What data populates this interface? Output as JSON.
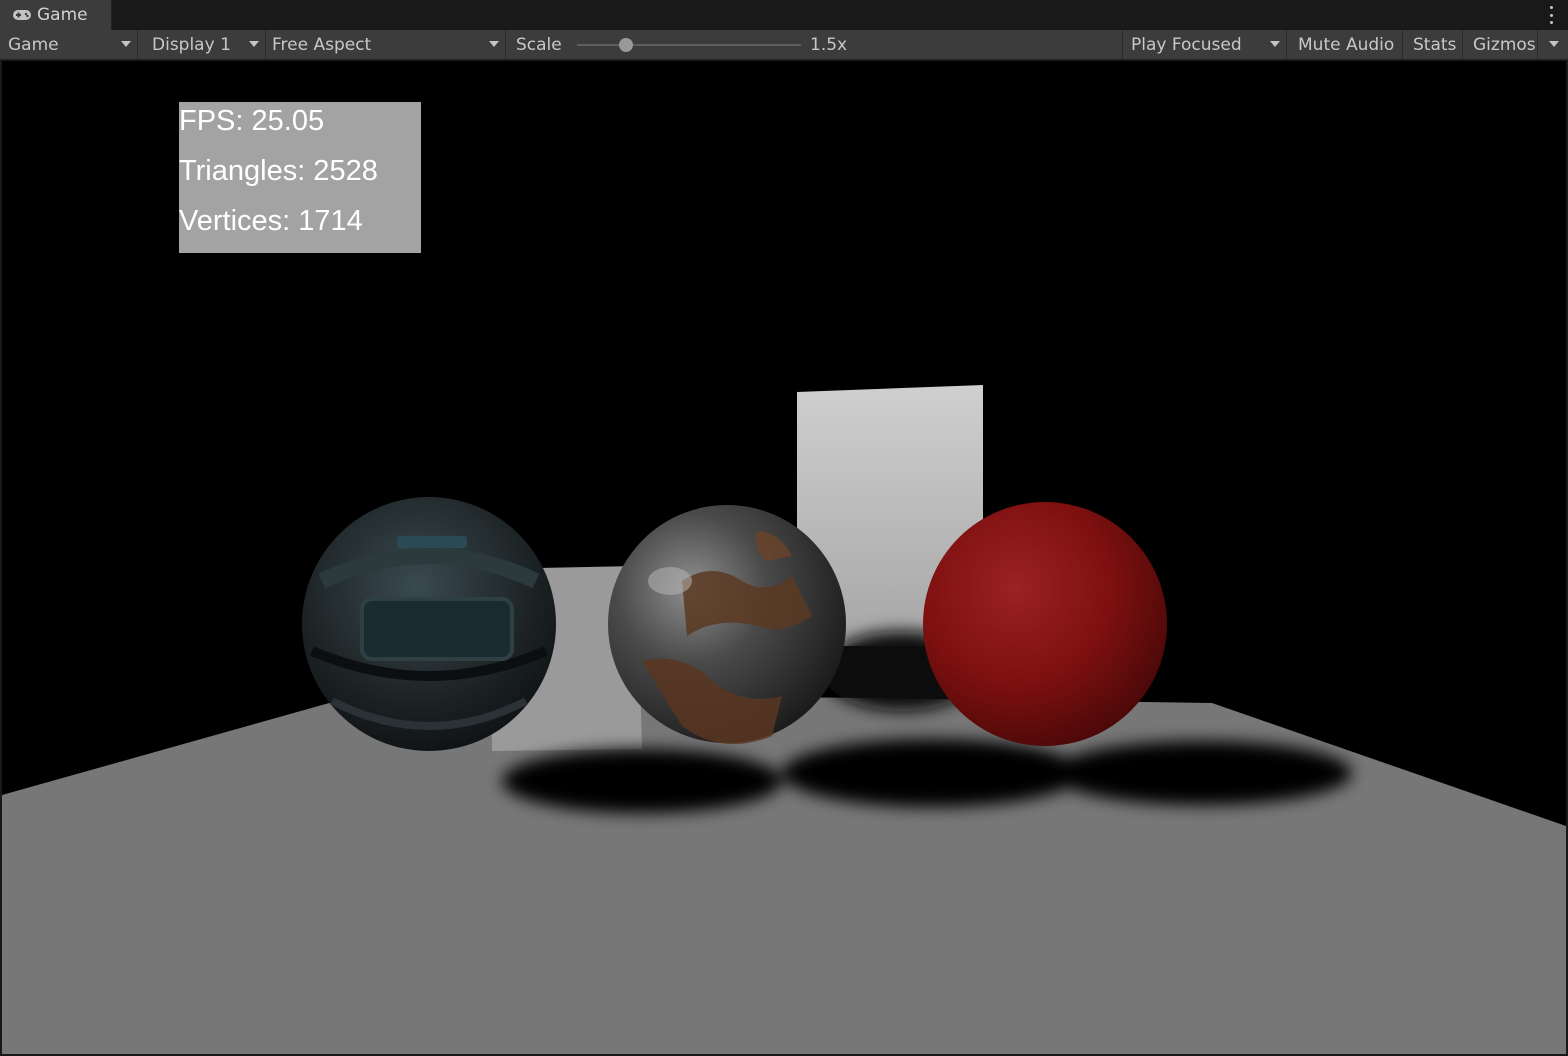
{
  "tab": {
    "title": "Game",
    "icon": "gamepad-icon"
  },
  "toolbar": {
    "mode": "Game",
    "display": "Display 1",
    "aspect": "Free Aspect",
    "scale_label": "Scale",
    "scale_value_text": "1.5x",
    "scale_level": 0.22,
    "play_focused": "Play Focused",
    "mute_audio": "Mute Audio",
    "stats": "Stats",
    "gizmos": "Gizmos"
  },
  "overlay": {
    "fps": "FPS: 25.05",
    "triangles": "Triangles: 2528",
    "vertices": "Vertices: 1714"
  },
  "scene": {
    "objects": [
      "textured-sphere",
      "rusty-metal-sphere",
      "red-sphere",
      "white-wall",
      "floor-plane",
      "back-wall"
    ],
    "colors": {
      "red_sphere": "#8a1212",
      "floor": "#777777",
      "wall": "#bdbdbd"
    }
  }
}
